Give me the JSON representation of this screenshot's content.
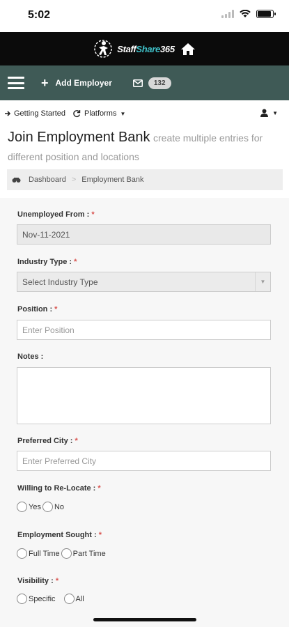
{
  "status": {
    "time": "5:02"
  },
  "logo": {
    "brand_a": "Staff",
    "brand_b": "Share",
    "brand_c": "365"
  },
  "navbar": {
    "add_employer": "Add Employer",
    "mail_count": "132"
  },
  "subnav": {
    "getting_started": "Getting Started",
    "platforms": "Platforms"
  },
  "page": {
    "title": "Join Employment Bank",
    "subtitle": "create multiple entries for different position and locations"
  },
  "breadcrumb": {
    "home": "Dashboard",
    "current": "Employment Bank"
  },
  "form": {
    "unemployed_from": {
      "label": "Unemployed From :",
      "required": "*",
      "value": "Nov-11-2021"
    },
    "industry_type": {
      "label": "Industry Type :",
      "required": "*",
      "value": "Select Industry Type"
    },
    "position": {
      "label": "Position :",
      "required": "*",
      "placeholder": "Enter Position"
    },
    "notes": {
      "label": "Notes :"
    },
    "preferred_city": {
      "label": "Preferred City :",
      "required": "*",
      "placeholder": "Enter Preferred City"
    },
    "relocate": {
      "label": "Willing to Re-Locate :",
      "required": "*",
      "options": [
        "Yes",
        "No"
      ]
    },
    "employment_sought": {
      "label": "Employment Sought :",
      "required": "*",
      "options": [
        "Full Time",
        "Part Time"
      ]
    },
    "visibility": {
      "label": "Visibility :",
      "required": "*",
      "options": [
        "Specific",
        "All"
      ]
    }
  },
  "colors": {
    "navbar": "#3f5a56",
    "header": "#0b0b0b",
    "accent": "#3fc0c8",
    "required": "#d9534f"
  }
}
